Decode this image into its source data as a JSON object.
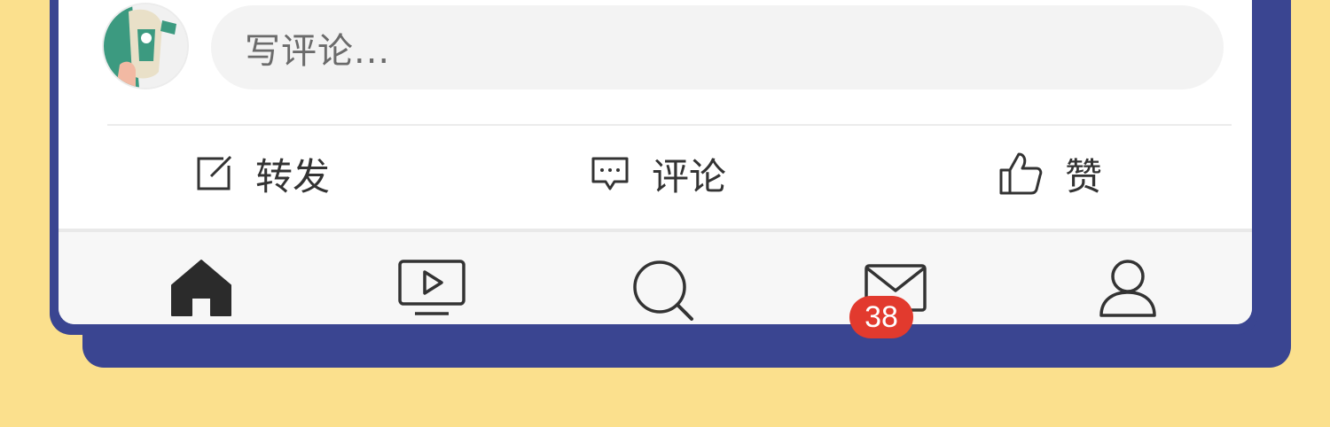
{
  "comment": {
    "placeholder": "写评论..."
  },
  "actions": {
    "share_label": "转发",
    "comment_label": "评论",
    "like_label": "赞"
  },
  "tabbar": {
    "items": [
      {
        "icon": "home-icon",
        "active": true
      },
      {
        "icon": "video-icon",
        "active": false
      },
      {
        "icon": "search-icon",
        "active": false
      },
      {
        "icon": "mail-icon",
        "active": false
      },
      {
        "icon": "profile-icon",
        "active": false
      }
    ],
    "mail_badge": "38"
  },
  "colors": {
    "background": "#fbe08d",
    "frame": "#3a4591",
    "badge": "#e23a2e"
  }
}
